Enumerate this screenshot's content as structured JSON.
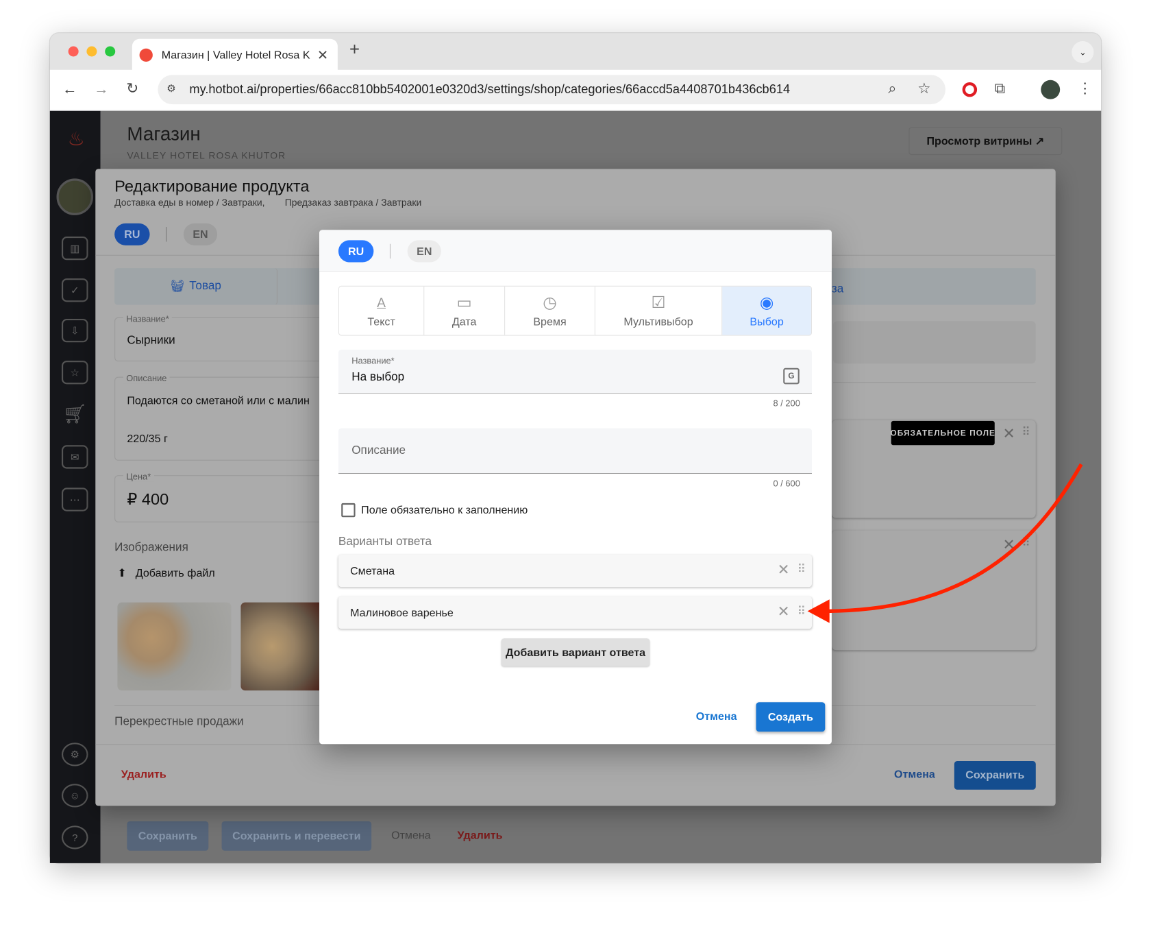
{
  "browser": {
    "tab_title": "Магазин | Valley Hotel Rosa K",
    "url": "my.hotbot.ai/properties/66acc810bb5402001e0320d3/settings/shop/categories/66accd5a4408701b436cb614"
  },
  "page": {
    "title": "Магазин",
    "subtitle": "VALLEY HOTEL ROSA KHUTOR",
    "storefront_button": "Просмотр витрины ↗",
    "bottom": {
      "save": "Сохранить",
      "save_translate": "Сохранить и перевести",
      "cancel": "Отмена",
      "delete": "Удалить"
    }
  },
  "product_dialog": {
    "title": "Редактирование продукта",
    "breadcrumb1": "Доставка еды в номер / Завтраки,",
    "breadcrumb2": "Предзаказ завтрака / Завтраки",
    "lang": {
      "ru": "RU",
      "en": "EN"
    },
    "tab_product": "Товар",
    "tab_right_fragment": "за",
    "name_label": "Название*",
    "name_value": "Сырники",
    "description_label": "Описание",
    "description_line1": "Подаются со сметаной или с малин",
    "description_line2": "220/35 г",
    "price_label": "Цена*",
    "price_value": "₽ 400",
    "images_label": "Изображения",
    "add_file": "Добавить файл",
    "cross_sales": "Перекрестные продажи",
    "required_badge": "ОБЯЗАТЕЛЬНОЕ ПОЛЕ",
    "delete": "Удалить",
    "cancel": "Отмена",
    "save": "Сохранить"
  },
  "field_modal": {
    "lang": {
      "ru": "RU",
      "en": "EN",
      "active": "RU"
    },
    "types": [
      {
        "label": "Текст",
        "icon": "text-icon"
      },
      {
        "label": "Дата",
        "icon": "calendar-icon"
      },
      {
        "label": "Время",
        "icon": "clock-icon"
      },
      {
        "label": "Мультивыбор",
        "icon": "checkbox-icon"
      },
      {
        "label": "Выбор",
        "icon": "radio-icon",
        "active": true
      }
    ],
    "name_label": "Название*",
    "name_value": "На выбор",
    "name_counter": "8 / 200",
    "description_placeholder": "Описание",
    "description_counter": "0 / 600",
    "required_checkbox_label": "Поле обязательно к заполнению",
    "required_checked": false,
    "options_label": "Варианты ответа",
    "options": [
      "Сметана",
      "Малиновое варенье"
    ],
    "add_option": "Добавить вариант ответа",
    "cancel": "Отмена",
    "create": "Создать"
  },
  "colors": {
    "accent": "#1976d2",
    "pill": "#2979ff",
    "danger": "#d32f2f",
    "annotation_arrow": "#ff2200"
  }
}
